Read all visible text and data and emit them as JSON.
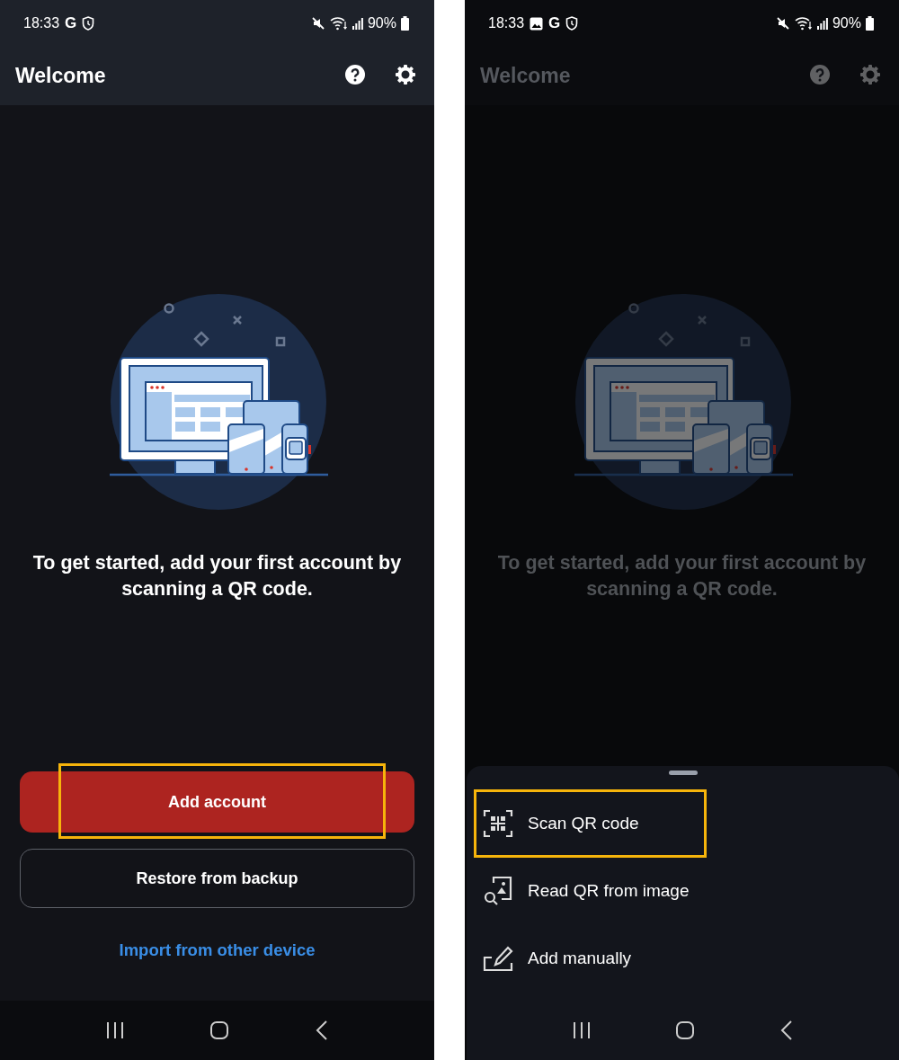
{
  "screens": [
    {
      "dimmed": false,
      "status_bar": {
        "time": "18:33",
        "notifications": [
          {
            "kind": "google",
            "label": "G"
          },
          {
            "kind": "shield"
          }
        ],
        "battery": "90%"
      },
      "app_bar": {
        "title": "Welcome"
      },
      "message": "To get started, add your first account by scanning a QR code.",
      "buttons": [
        {
          "kind": "primary",
          "label": "Add account",
          "highlighted": true
        },
        {
          "kind": "outlined",
          "label": "Restore from backup",
          "highlighted": false
        }
      ],
      "link": "Import from other device"
    },
    {
      "dimmed": true,
      "status_bar": {
        "time": "18:33",
        "notifications": [
          {
            "kind": "gallery"
          },
          {
            "kind": "google",
            "label": "G"
          },
          {
            "kind": "shield"
          }
        ],
        "battery": "90%"
      },
      "app_bar": {
        "title": "Welcome"
      },
      "message": "To get started, add your first account by scanning a QR code.",
      "sheet": {
        "items": [
          {
            "kind": "scan",
            "label": "Scan QR code",
            "highlighted": true
          },
          {
            "kind": "image",
            "label": "Read QR from image",
            "highlighted": false
          },
          {
            "kind": "manual",
            "label": "Add manually",
            "highlighted": false
          }
        ]
      }
    }
  ]
}
